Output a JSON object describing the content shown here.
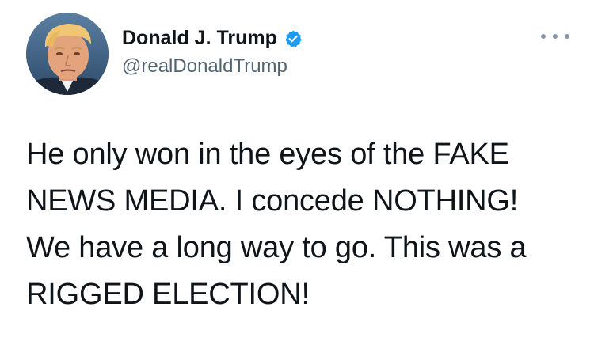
{
  "author": {
    "display_name": "Donald J. Trump",
    "handle": "@realDonaldTrump",
    "verified_badge_icon": "verified-check-icon",
    "avatar_icon": "profile-photo"
  },
  "menu": {
    "icon": "more-options-icon"
  },
  "tweet": {
    "lines": [
      "He only won in the eyes of the FAKE",
      "NEWS MEDIA. I concede NOTHING!",
      "We have a long way to go. This was a",
      "RIGGED ELECTION!"
    ]
  },
  "colors": {
    "verified_blue": "#1d9bf0",
    "text_primary": "#0f1419",
    "text_secondary": "#536471"
  }
}
